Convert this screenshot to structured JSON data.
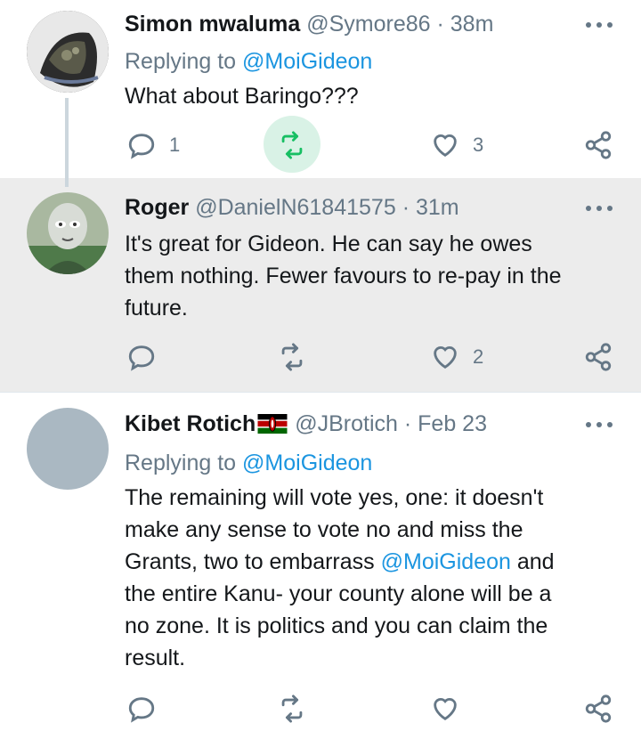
{
  "tweets": [
    {
      "author_name": "Simon mwaluma",
      "handle": "@Symore86",
      "separator": "·",
      "time": "38m",
      "replying_prefix": "Replying to ",
      "replying_mention": "@MoiGideon",
      "text": "What about Baringo???",
      "reply_count": "1",
      "like_count": "3"
    },
    {
      "author_name": "Roger",
      "handle": "@DanielN61841575",
      "separator": "·",
      "time": "31m",
      "text_lines": [
        "It's great for Gideon. He can say he owes",
        "them nothing. Fewer favours to re-pay in the",
        "future."
      ],
      "like_count": "2"
    },
    {
      "author_name": "Kibet Rotich",
      "handle": "@JBrotich",
      "separator": "·",
      "time": "Feb 23",
      "replying_prefix": "Replying to ",
      "replying_mention": "@MoiGideon",
      "text_line1": "The remaining will vote yes, one: it doesn't",
      "text_line2": "make any sense to vote no and miss the",
      "text_line3a": "Grants, two to embarrass ",
      "text_line3_mention": "@MoiGideon",
      "text_line3b": " and",
      "text_line4": "the entire Kanu- your county alone will be a",
      "text_line5": "no zone. It is politics and you can claim the",
      "text_line6": "result."
    }
  ],
  "icons": {
    "reply": "reply-icon",
    "retweet": "retweet-icon",
    "like": "heart-icon",
    "share": "share-icon",
    "more": "more-icon",
    "flag": "kenya-flag-icon"
  },
  "colors": {
    "link": "#1b95e0",
    "muted": "#657786",
    "highlight_bg": "#ececec",
    "retweet_highlight": "#d9f2e6"
  }
}
